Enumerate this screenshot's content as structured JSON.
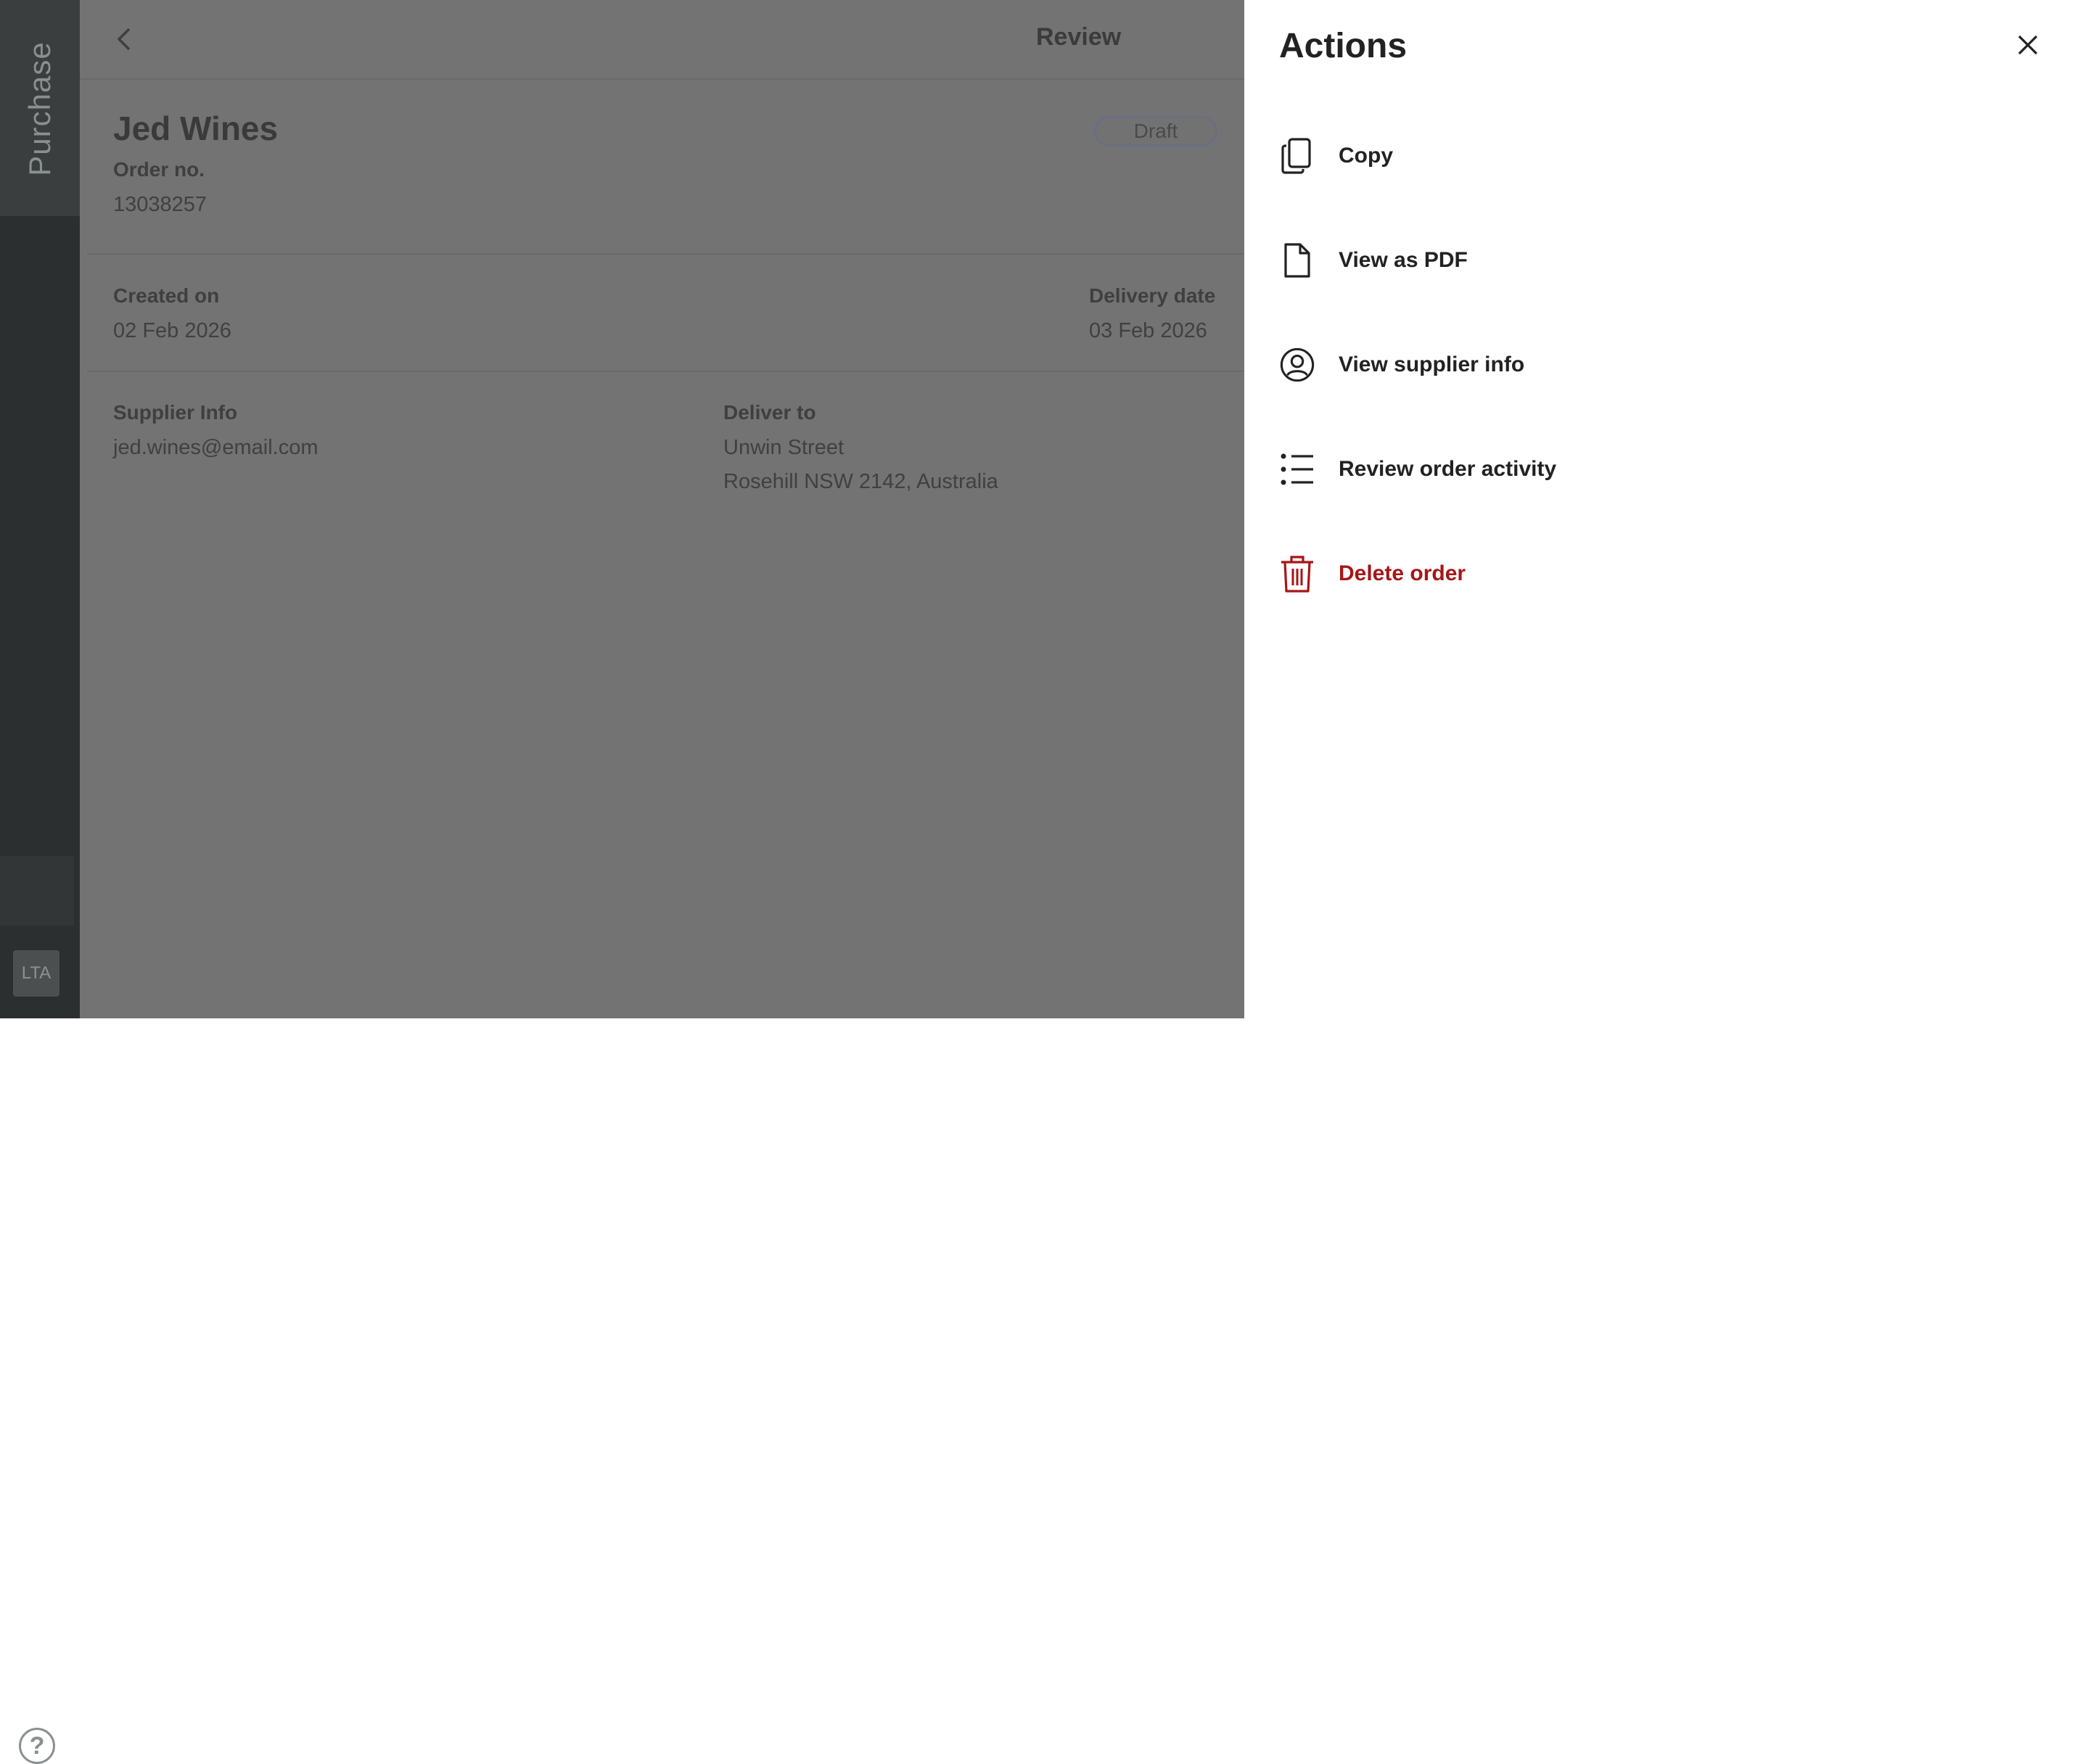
{
  "sidebar": {
    "title": "Purchase",
    "help_icon": "?",
    "user_initials": "LTA"
  },
  "header": {
    "title": "Review"
  },
  "order": {
    "supplier": "Jed Wines",
    "status": "Draft",
    "order_no_label": "Order no.",
    "order_no": "13038257",
    "created_label": "Created on",
    "created_value": "02 Feb 2026",
    "delivery_label": "Delivery date",
    "delivery_value": "03 Feb 2026",
    "supplier_info_label": "Supplier Info",
    "supplier_email": "jed.wines@email.com",
    "deliver_to_label": "Deliver to",
    "deliver_to_line1": "Unwin Street",
    "deliver_to_line2": "Rosehill NSW 2142, Australia"
  },
  "drawer": {
    "title": "Actions",
    "actions": [
      {
        "label": "Copy",
        "icon": "copy-icon"
      },
      {
        "label": "View as PDF",
        "icon": "file-icon"
      },
      {
        "label": "View supplier info",
        "icon": "user-circle-icon"
      },
      {
        "label": "Review order activity",
        "icon": "list-icon"
      },
      {
        "label": "Delete order",
        "icon": "trash-icon",
        "color": "#a61616"
      }
    ]
  }
}
